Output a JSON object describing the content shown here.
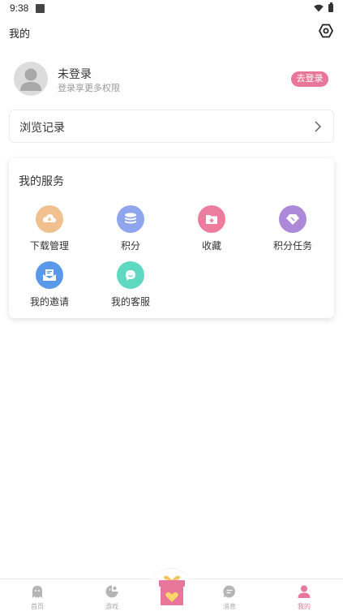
{
  "status_bar": {
    "time": "9:38"
  },
  "header": {
    "title": "我的"
  },
  "profile": {
    "name": "未登录",
    "subtitle": "登录享更多权限",
    "login_label": "去登录"
  },
  "history": {
    "label": "浏览记录"
  },
  "services": {
    "title": "我的服务",
    "items": [
      {
        "label": "下载管理",
        "icon": "download-icon",
        "color": "#f0c08e"
      },
      {
        "label": "积分",
        "icon": "coins-icon",
        "color": "#8fa6ee"
      },
      {
        "label": "收藏",
        "icon": "favorite-folder-icon",
        "color": "#ec7d9e"
      },
      {
        "label": "积分任务",
        "icon": "diamond-icon",
        "color": "#ad8ad9"
      },
      {
        "label": "我的邀请",
        "icon": "invite-envelope-icon",
        "color": "#5a99ea"
      },
      {
        "label": "我的客服",
        "icon": "customer-service-icon",
        "color": "#5fd8c1"
      }
    ]
  },
  "bottom_nav": {
    "items": [
      {
        "label": "首页",
        "icon": "home-ghost-icon"
      },
      {
        "label": "游戏",
        "icon": "game-icon"
      },
      {
        "label": "消息",
        "icon": "message-icon"
      },
      {
        "label": "我的",
        "icon": "profile-icon"
      }
    ],
    "center_icon": "gift-icon"
  },
  "colors": {
    "accent": "#e8769a",
    "nav_inactive": "#aaaaaa"
  }
}
